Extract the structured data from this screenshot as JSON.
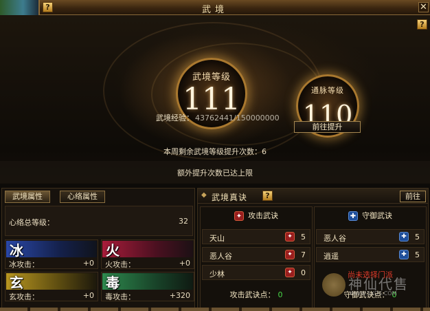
{
  "window": {
    "title": "武境",
    "help_label": "?",
    "close_label": "✕"
  },
  "hero": {
    "main_orb": {
      "label": "武境等级",
      "value": "111"
    },
    "sub_orb": {
      "label": "通脉等级",
      "value": "110"
    },
    "exp_label": "武境经验：",
    "exp_value": "43762441/150000000",
    "goto_upgrade_label": "前往提升",
    "weekly_text": "本周剩余武境等级提升次数：6",
    "bonus_text": "额外提升次数已达上限"
  },
  "left_panel": {
    "tabs": [
      {
        "label": "武境属性",
        "active": true
      },
      {
        "label": "心络属性",
        "active": false
      }
    ],
    "meridian": {
      "label": "心络总等级：",
      "value": "32"
    },
    "elements": [
      {
        "glyph": "冰",
        "label": "冰攻击：",
        "value": "+0",
        "color": "#2a48a8"
      },
      {
        "glyph": "火",
        "label": "火攻击：",
        "value": "+0",
        "color": "#a81c3a"
      },
      {
        "glyph": "玄",
        "label": "玄攻击：",
        "value": "+0",
        "color": "#b89620"
      },
      {
        "glyph": "毒",
        "label": "毒攻击：",
        "value": "+320",
        "color": "#2e8a4e"
      }
    ]
  },
  "right_panel": {
    "title": "武境真诀",
    "help_label": "?",
    "goto_label": "前往",
    "attack": {
      "header": "攻击武诀",
      "rows": [
        {
          "name": "天山",
          "count": "5"
        },
        {
          "name": "恶人谷",
          "count": "7"
        },
        {
          "name": "少林",
          "count": "0"
        }
      ],
      "points_label": "攻击武诀点：",
      "points_value": "0"
    },
    "defense": {
      "header": "守御武诀",
      "rows": [
        {
          "name": "恶人谷",
          "count": "5"
        },
        {
          "name": "逍遥",
          "count": "5"
        }
      ],
      "not_chosen_text": "尚未选择门派",
      "points_label": "守御武诀点：",
      "points_value": "0"
    }
  },
  "watermark": {
    "text": "神仙代售",
    "url": "WWW.SXDS.COM"
  },
  "colors": {
    "accent_gold": "#a9782f",
    "highlight_green": "#48d848",
    "warning_red": "#e03a2a"
  }
}
